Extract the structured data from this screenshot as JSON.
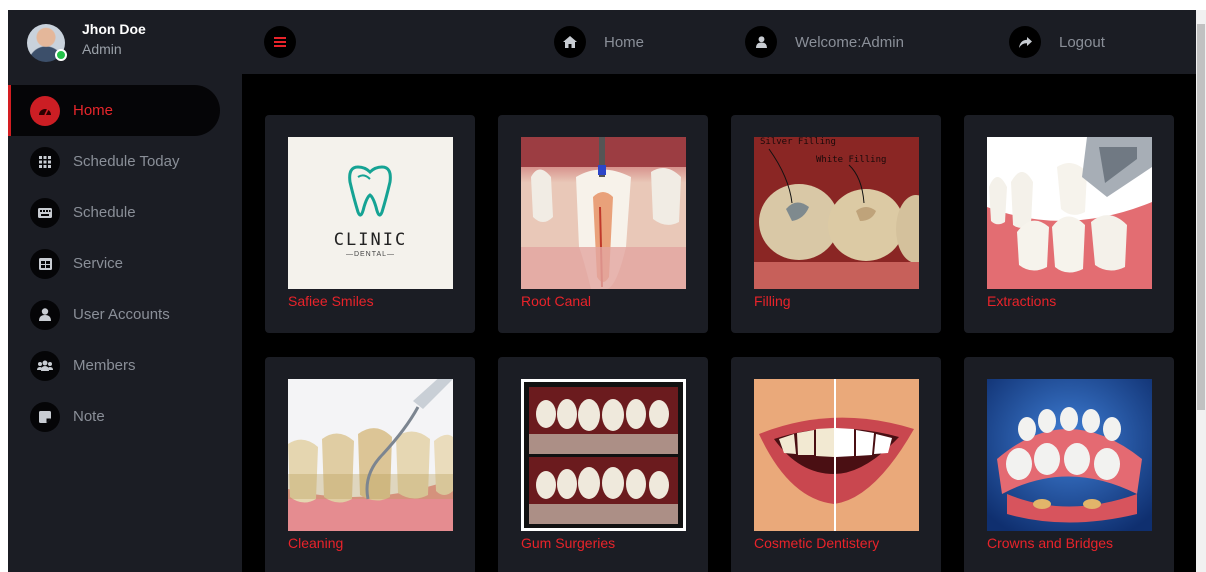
{
  "profile": {
    "name": "Jhon Doe",
    "role": "Admin"
  },
  "sidebar": {
    "items": [
      {
        "label": "Home",
        "icon": "dashboard-icon",
        "active": true
      },
      {
        "label": "Schedule Today",
        "icon": "grid-icon"
      },
      {
        "label": "Schedule",
        "icon": "keyboard-icon"
      },
      {
        "label": "Service",
        "icon": "table-icon"
      },
      {
        "label": "User Accounts",
        "icon": "user-icon"
      },
      {
        "label": "Members",
        "icon": "users-icon"
      },
      {
        "label": "Note",
        "icon": "sticky-note-icon"
      }
    ]
  },
  "topbar": {
    "home_label": "Home",
    "welcome_label": "Welcome:Admin",
    "logout_label": "Logout"
  },
  "services": [
    {
      "title": "Safiee Smiles",
      "image": "clinic-logo"
    },
    {
      "title": "Root Canal",
      "image": "root-canal"
    },
    {
      "title": "Filling",
      "image": "filling",
      "image_text": [
        "Silver Filling",
        "White Filling"
      ]
    },
    {
      "title": "Extractions",
      "image": "extraction"
    },
    {
      "title": "Cleaning",
      "image": "cleaning"
    },
    {
      "title": "Gum Surgeries",
      "image": "gum-surgery"
    },
    {
      "title": "Cosmetic Dentistery",
      "image": "cosmetic"
    },
    {
      "title": "Crowns and Bridges",
      "image": "crowns"
    }
  ],
  "logo": {
    "word": "CLINIC",
    "sub": "DENTAL"
  },
  "colors": {
    "accent": "#e8232a",
    "panel": "#1b1d24",
    "background": "#000000"
  }
}
